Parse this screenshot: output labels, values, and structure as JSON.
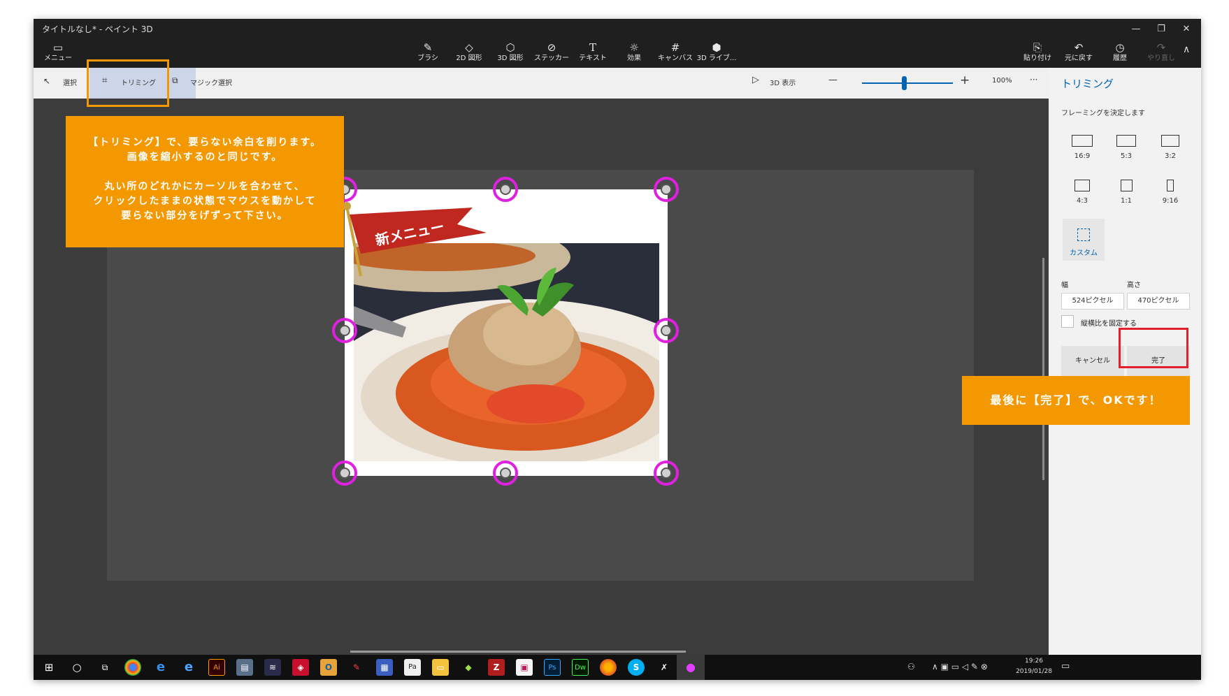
{
  "window": {
    "title": "タイトルなし* - ペイント 3D"
  },
  "titlebar": {
    "menu_label": "メニュー",
    "tools": [
      {
        "label": "ブラシ",
        "icon": "brush-icon"
      },
      {
        "label": "2D 図形",
        "icon": "2d-shapes-icon"
      },
      {
        "label": "3D 図形",
        "icon": "3d-shapes-icon"
      },
      {
        "label": "ステッカー",
        "icon": "sticker-icon"
      },
      {
        "label": "テキスト",
        "icon": "text-icon"
      },
      {
        "label": "効果",
        "icon": "effects-icon"
      },
      {
        "label": "キャンバス",
        "icon": "canvas-icon"
      },
      {
        "label": "3D ライブ...",
        "icon": "3d-library-icon"
      }
    ],
    "right_tools": [
      {
        "label": "貼り付け",
        "icon": "paste-icon"
      },
      {
        "label": "元に戻す",
        "icon": "undo-icon"
      },
      {
        "label": "履歴",
        "icon": "history-icon"
      },
      {
        "label": "やり直し",
        "icon": "redo-icon"
      }
    ]
  },
  "subbar": {
    "select_label": "選択",
    "trim_label": "トリミング",
    "magic_select_label": "マジック選択",
    "view3d_label": "3D 表示",
    "zoom_minus": "—",
    "zoom_plus": "+",
    "zoom_value": "100%",
    "more": "···"
  },
  "panel": {
    "title": "トリミング",
    "subtitle": "フレーミングを決定します",
    "aspects": [
      "16:9",
      "5:3",
      "3:2",
      "4:3",
      "1:1",
      "9:16"
    ],
    "custom_label": "カスタム",
    "width_label": "幅",
    "height_label": "高さ",
    "width_value": "524ピクセル",
    "height_value": "470ピクセル",
    "lock_ratio_label": "縦横比を固定する",
    "cancel_label": "キャンセル",
    "done_label": "完了"
  },
  "image": {
    "banner_text": "新メニュー"
  },
  "callouts": {
    "main_line1": "【トリミング】で、要らない余白を削ります。",
    "main_line2": "画像を縮小するのと同じです。",
    "main_line3": "丸い所のどれかにカーソルを合わせて、",
    "main_line4": "クリックしたままの状態でマウスを動かして",
    "main_line5": "要らない部分をげずって下さい。",
    "done_text": "最後に【完了】で、OKです！"
  },
  "taskbar": {
    "time": "19:26",
    "date": "2019/01/28",
    "apps": [
      "Ai",
      "O",
      "Ps",
      "Dw",
      "S",
      "Pa"
    ]
  },
  "colors": {
    "callout": "#f39800",
    "handle": "#e020e0",
    "highlight_done": "#e5202e",
    "highlight_trim": "#f39800",
    "accent": "#0063b1"
  }
}
